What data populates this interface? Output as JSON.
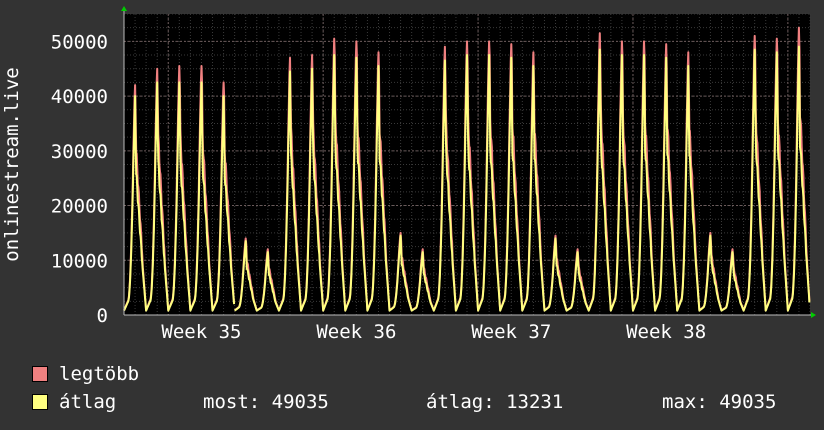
{
  "chart_data": {
    "type": "line",
    "ylabel": "onlinestream.live",
    "ylim": [
      0,
      55000
    ],
    "yticks": [
      0,
      10000,
      20000,
      30000,
      40000,
      50000
    ],
    "ytick_labels": [
      "0",
      "10000",
      "20000",
      "30000",
      "40000",
      "50000"
    ],
    "xticks": [
      "Week 35",
      "Week 36",
      "Week 37",
      "Week 38"
    ],
    "grid": true,
    "background": "#000000",
    "gap_after_day": 5,
    "series": [
      {
        "name": "legtöbb",
        "color": "#F08080",
        "daily_peaks": [
          42000,
          45000,
          45500,
          45500,
          42500,
          14000,
          12000,
          47000,
          47500,
          50500,
          50000,
          48000,
          15000,
          12000,
          49000,
          50000,
          50000,
          49500,
          48000,
          14500,
          12000,
          51500,
          50000,
          50000,
          49500,
          48000,
          15000,
          12000,
          51000,
          50500,
          52500
        ]
      },
      {
        "name": "átlag",
        "color": "#FFFF80",
        "daily_peaks": [
          40000,
          42500,
          42500,
          42500,
          40000,
          13500,
          11500,
          44500,
          45000,
          47500,
          47000,
          45500,
          14500,
          11500,
          46500,
          47500,
          47500,
          47000,
          45500,
          14000,
          11500,
          48500,
          47500,
          47500,
          47000,
          45500,
          14500,
          11500,
          48500,
          48000,
          49035
        ]
      }
    ]
  },
  "legend": {
    "max_label": "legtöbb",
    "avg_label": "átlag",
    "now_text": "most: 49035",
    "avg_text": "átlag: 13231",
    "max_text": "max: 49035"
  }
}
